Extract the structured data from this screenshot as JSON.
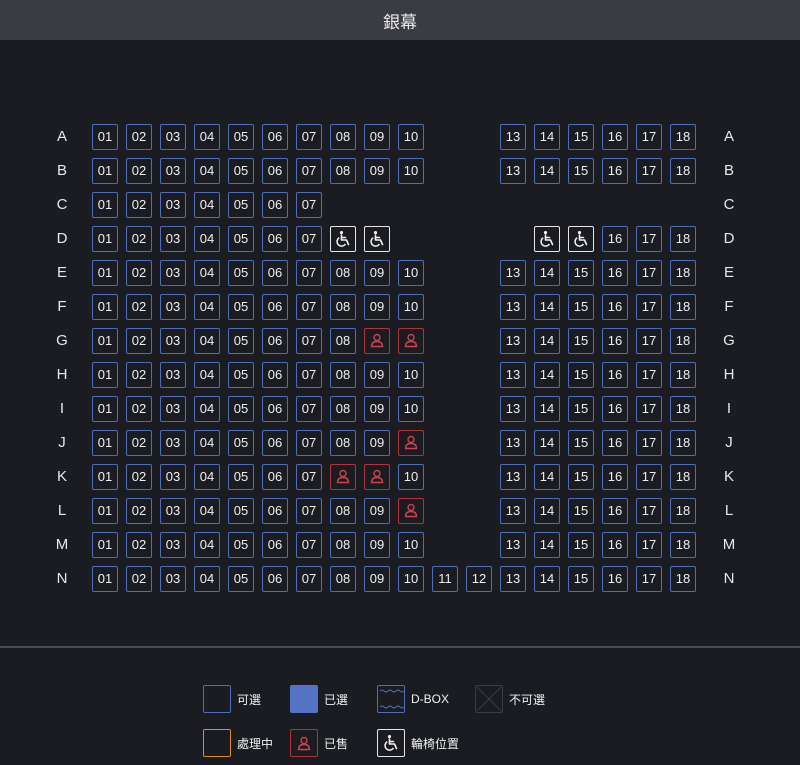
{
  "screen": {
    "label": "銀幕"
  },
  "rows": [
    {
      "label": "A",
      "left": [
        "01",
        "02",
        "03",
        "04",
        "05",
        "06",
        "07",
        "08",
        "09",
        "10"
      ],
      "middle": [],
      "right": [
        "13",
        "14",
        "15",
        "16",
        "17",
        "18"
      ]
    },
    {
      "label": "B",
      "left": [
        "01",
        "02",
        "03",
        "04",
        "05",
        "06",
        "07",
        "08",
        "09",
        "10"
      ],
      "middle": [],
      "right": [
        "13",
        "14",
        "15",
        "16",
        "17",
        "18"
      ]
    },
    {
      "label": "C",
      "left": [
        "01",
        "02",
        "03",
        "04",
        "05",
        "06",
        "07"
      ],
      "middle": [],
      "right": []
    },
    {
      "label": "D",
      "left": [
        "01",
        "02",
        "03",
        "04",
        "05",
        "06",
        "07",
        "wheelchair",
        "wheelchair"
      ],
      "middle": [],
      "right": [
        "wheelchair",
        "wheelchair",
        "16",
        "17",
        "18"
      ]
    },
    {
      "label": "E",
      "left": [
        "01",
        "02",
        "03",
        "04",
        "05",
        "06",
        "07",
        "08",
        "09",
        "10"
      ],
      "middle": [],
      "right": [
        "13",
        "14",
        "15",
        "16",
        "17",
        "18"
      ]
    },
    {
      "label": "F",
      "left": [
        "01",
        "02",
        "03",
        "04",
        "05",
        "06",
        "07",
        "08",
        "09",
        "10"
      ],
      "middle": [],
      "right": [
        "13",
        "14",
        "15",
        "16",
        "17",
        "18"
      ]
    },
    {
      "label": "G",
      "left": [
        "01",
        "02",
        "03",
        "04",
        "05",
        "06",
        "07",
        "08",
        "sold",
        "sold"
      ],
      "middle": [],
      "right": [
        "13",
        "14",
        "15",
        "16",
        "17",
        "18"
      ]
    },
    {
      "label": "H",
      "left": [
        "01",
        "02",
        "03",
        "04",
        "05",
        "06",
        "07",
        "08",
        "09",
        "10"
      ],
      "middle": [],
      "right": [
        "13",
        "14",
        "15",
        "16",
        "17",
        "18"
      ]
    },
    {
      "label": "I",
      "left": [
        "01",
        "02",
        "03",
        "04",
        "05",
        "06",
        "07",
        "08",
        "09",
        "10"
      ],
      "middle": [],
      "right": [
        "13",
        "14",
        "15",
        "16",
        "17",
        "18"
      ]
    },
    {
      "label": "J",
      "left": [
        "01",
        "02",
        "03",
        "04",
        "05",
        "06",
        "07",
        "08",
        "09",
        "sold"
      ],
      "middle": [],
      "right": [
        "13",
        "14",
        "15",
        "16",
        "17",
        "18"
      ]
    },
    {
      "label": "K",
      "left": [
        "01",
        "02",
        "03",
        "04",
        "05",
        "06",
        "07",
        "sold",
        "sold",
        "10"
      ],
      "middle": [],
      "right": [
        "13",
        "14",
        "15",
        "16",
        "17",
        "18"
      ]
    },
    {
      "label": "L",
      "left": [
        "01",
        "02",
        "03",
        "04",
        "05",
        "06",
        "07",
        "08",
        "09",
        "sold"
      ],
      "middle": [],
      "right": [
        "13",
        "14",
        "15",
        "16",
        "17",
        "18"
      ]
    },
    {
      "label": "M",
      "left": [
        "01",
        "02",
        "03",
        "04",
        "05",
        "06",
        "07",
        "08",
        "09",
        "10"
      ],
      "middle": [],
      "right": [
        "13",
        "14",
        "15",
        "16",
        "17",
        "18"
      ]
    },
    {
      "label": "N",
      "left": [
        "01",
        "02",
        "03",
        "04",
        "05",
        "06",
        "07",
        "08",
        "09",
        "10"
      ],
      "middle": [
        "11",
        "12"
      ],
      "right": [
        "13",
        "14",
        "15",
        "16",
        "17",
        "18"
      ]
    }
  ],
  "legend": [
    {
      "key": "available",
      "label": "可選"
    },
    {
      "key": "selected",
      "label": "已選"
    },
    {
      "key": "dbox",
      "label": "D-BOX"
    },
    {
      "key": "unavailable",
      "label": "不可選"
    },
    {
      "key": "processing",
      "label": "處理中"
    },
    {
      "key": "sold",
      "label": "已售"
    },
    {
      "key": "wheelchair",
      "label": "輪椅位置"
    }
  ],
  "colors": {
    "background": "#1a1c22",
    "seat_border": "#4f6db8",
    "selected_fill": "#5672c4",
    "sold": "#b3313a",
    "processing": "#e08a2e",
    "wheelchair": "#e6e6e6",
    "unavailable": "#3a3c48"
  }
}
